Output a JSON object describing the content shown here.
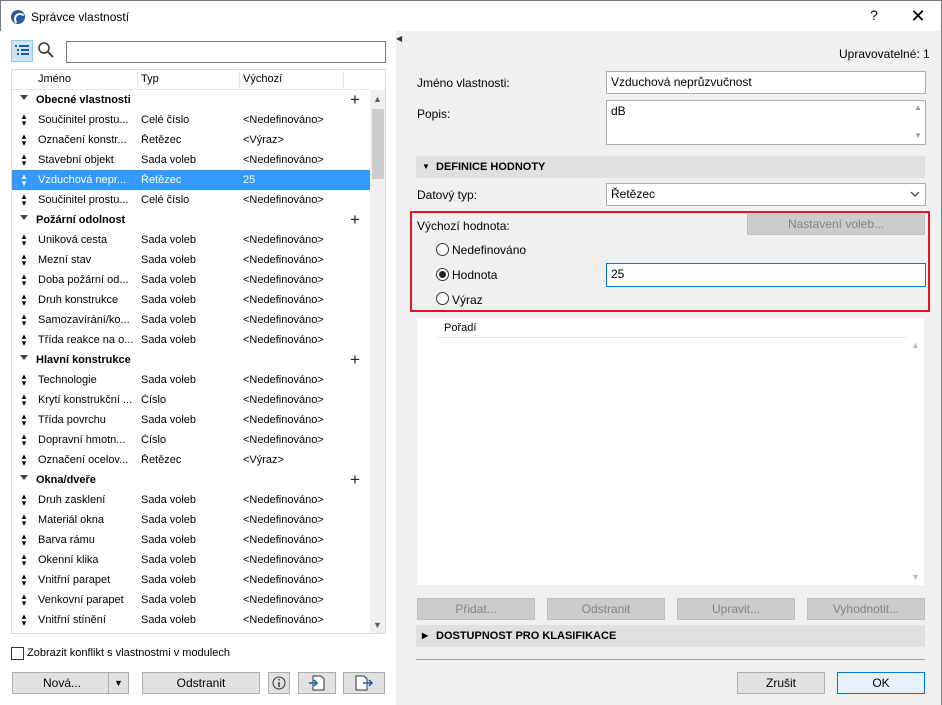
{
  "window": {
    "title": "Správce vlastností",
    "help": "?",
    "close": "✕"
  },
  "toolbar": {
    "list_icon": "list-view-icon",
    "search_icon": "search-icon",
    "search_value": ""
  },
  "tree": {
    "columns": [
      "Jméno",
      "Typ",
      "Výchozí"
    ],
    "groups": [
      {
        "name": "Obecné vlastnosti",
        "rows": [
          {
            "name": "Součinitel prostu...",
            "type": "Celé číslo",
            "default": "<Nedefinováno>"
          },
          {
            "name": "Označení konstr...",
            "type": "Řetězec",
            "default": "<Výraz>"
          },
          {
            "name": "Stavební objekt",
            "type": "Sada voleb",
            "default": "<Nedefinováno>"
          },
          {
            "name": "Vzduchová nepr...",
            "type": "Řetězec",
            "default": "25",
            "selected": true
          },
          {
            "name": "Součinitel prostu...",
            "type": "Celé číslo",
            "default": "<Nedefinováno>"
          }
        ]
      },
      {
        "name": "Požární odolnost",
        "rows": [
          {
            "name": "Úniková cesta",
            "type": "Sada voleb",
            "default": "<Nedefinováno>"
          },
          {
            "name": "Mezní stav",
            "type": "Sada voleb",
            "default": "<Nedefinováno>"
          },
          {
            "name": "Doba požární od...",
            "type": "Sada voleb",
            "default": "<Nedefinováno>"
          },
          {
            "name": "Druh konstrukce",
            "type": "Sada voleb",
            "default": "<Nedefinováno>"
          },
          {
            "name": "Samozavírání/ko...",
            "type": "Sada voleb",
            "default": "<Nedefinováno>"
          },
          {
            "name": "Třída reakce na o...",
            "type": "Sada voleb",
            "default": "<Nedefinováno>"
          }
        ]
      },
      {
        "name": "Hlavní konstrukce",
        "rows": [
          {
            "name": "Technologie",
            "type": "Sada voleb",
            "default": "<Nedefinováno>"
          },
          {
            "name": "Krytí konstrukční ...",
            "type": "Číslo",
            "default": "<Nedefinováno>"
          },
          {
            "name": "Třída povrchu",
            "type": "Sada voleb",
            "default": "<Nedefinováno>"
          },
          {
            "name": "Dopravní hmotn...",
            "type": "Číslo",
            "default": "<Nedefinováno>"
          },
          {
            "name": "Označení ocelov...",
            "type": "Řetězec",
            "default": "<Výraz>"
          }
        ]
      },
      {
        "name": "Okna/dveře",
        "rows": [
          {
            "name": "Druh zasklení",
            "type": "Sada voleb",
            "default": "<Nedefinováno>"
          },
          {
            "name": "Materiál okna",
            "type": "Sada voleb",
            "default": "<Nedefinováno>"
          },
          {
            "name": "Barva rámu",
            "type": "Sada voleb",
            "default": "<Nedefinováno>"
          },
          {
            "name": "Okenní klika",
            "type": "Sada voleb",
            "default": "<Nedefinováno>"
          },
          {
            "name": "Vnitřní parapet",
            "type": "Sada voleb",
            "default": "<Nedefinováno>"
          },
          {
            "name": "Venkovní parapet",
            "type": "Sada voleb",
            "default": "<Nedefinováno>"
          },
          {
            "name": "Vnitřní stínění",
            "type": "Sada voleb",
            "default": "<Nedefinováno>"
          }
        ]
      }
    ]
  },
  "left_footer": {
    "conflict_label": "Zobrazit konflikt s vlastnostmi v modulech",
    "new_button": "Nová...",
    "delete_button": "Odstranit",
    "info_icon": "info-icon",
    "import_icon": "import-icon",
    "export_icon": "export-icon"
  },
  "right": {
    "editable": "Upravovatelné: 1",
    "name_label": "Jméno vlastnosti:",
    "name_value": "Vzduchová neprůzvučnost",
    "desc_label": "Popis:",
    "desc_value": "dB",
    "section_value": "DEFINICE HODNOTY",
    "datatype_label": "Datový typ:",
    "datatype_value": "Řetězec",
    "default_label": "Výchozí hodnota:",
    "options_button": "Nastavení voleb...",
    "radio_undefined": "Nedefinováno",
    "radio_value": "Hodnota",
    "radio_expr": "Výraz",
    "value_input": "25",
    "order_header": "Pořadí",
    "add_button": "Přidat...",
    "remove_button": "Odstranit",
    "edit_button": "Upravit...",
    "evaluate_button": "Vyhodnotit...",
    "section_access": "DOSTUPNOST PRO KLASIFIKACE",
    "cancel_button": "Zrušit",
    "ok_button": "OK"
  }
}
